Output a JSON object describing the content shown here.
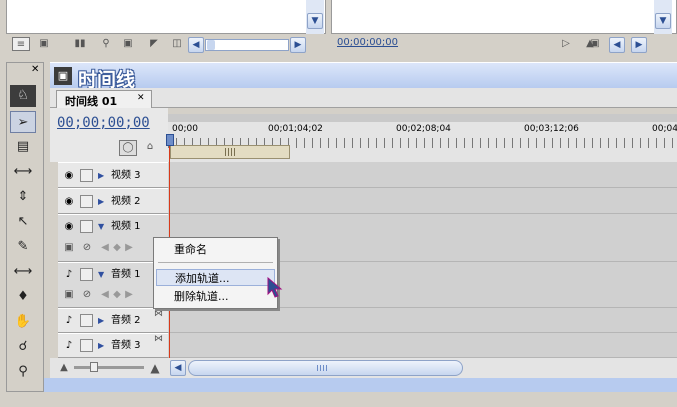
{
  "top_panels": {
    "left_toolbar_icons": [
      "list-view-icon",
      "icon-view-icon",
      "automate-icon",
      "find-icon",
      "bin-icon",
      "new-item-icon",
      "clear-icon"
    ],
    "right_timecode": "00;00;00;00"
  },
  "tools": [
    "track-select-icon",
    "selection-icon",
    "ripple-edit-icon",
    "rolling-edit-icon",
    "rate-stretch-icon",
    "razor-icon",
    "slip-icon",
    "slide-icon",
    "pen-icon",
    "hand-icon",
    "zoom-icon"
  ],
  "timeline": {
    "window_title": "时间线",
    "tab_label": "时间线 01",
    "current_timecode": "00;00;00;00",
    "ruler_labels": [
      "00;00",
      "00;01;04;02",
      "00;02;08;04",
      "00;03;12;06",
      "00;04"
    ],
    "tracks": [
      {
        "name": "视频 3",
        "kind": "video",
        "expanded": false
      },
      {
        "name": "视频 2",
        "kind": "video",
        "expanded": false
      },
      {
        "name": "视频 1",
        "kind": "video",
        "expanded": true
      },
      {
        "name": "音频 1",
        "kind": "audio",
        "expanded": true
      },
      {
        "name": "音频 2",
        "kind": "audio",
        "expanded": false
      },
      {
        "name": "音频 3",
        "kind": "audio",
        "expanded": false
      }
    ]
  },
  "context_menu": {
    "items": [
      {
        "label": "重命名",
        "highlighted": false
      },
      {
        "label": "添加轨道...",
        "highlighted": true
      },
      {
        "label": "删除轨道...",
        "highlighted": false
      }
    ]
  },
  "colors": {
    "title_bar": "#b7cbef",
    "accent": "#2c4f93",
    "playhead": "#d83a1a"
  }
}
